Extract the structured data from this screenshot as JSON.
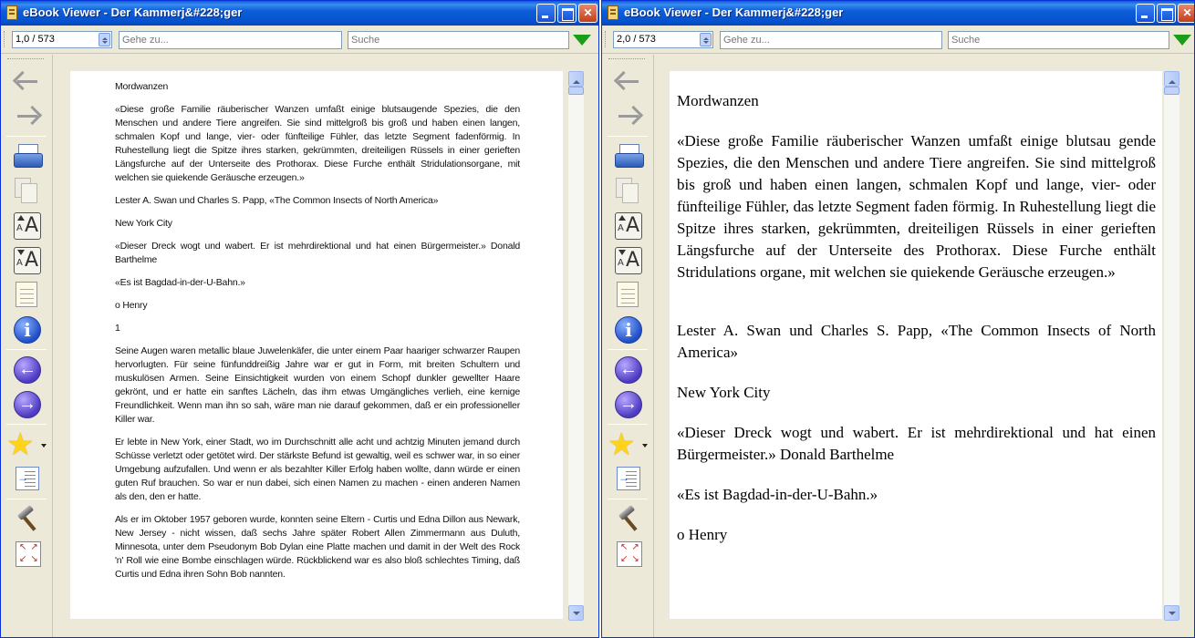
{
  "windows": [
    {
      "title": "eBook Viewer - Der Kammerj&#228;ger",
      "page_indicator": "1,0 / 573",
      "goto_placeholder": "Gehe zu...",
      "search_placeholder": "Suche",
      "paragraphs": [
        "Mordwanzen",
        "«Diese große Familie räuberischer Wanzen umfaßt einige blutsaugende Spezies, die den Menschen und andere Tiere angreifen. Sie sind mittelgroß bis groß und haben einen langen, schmalen Kopf und lange, vier- oder fünfteilige Fühler, das letzte Segment fadenförmig. In Ruhestellung liegt die Spitze ihres starken, gekrümmten, dreiteiligen Rüssels in einer gerieften Längsfurche auf der Unterseite des Prothorax. Diese Furche enthält Stridulationsorgane, mit welchen sie quiekende Geräusche erzeugen.»",
        "Lester A. Swan und Charles S. Papp, «The Common Insects of North America»",
        "New York City",
        "«Dieser Dreck wogt und wabert. Er ist mehrdirektional und hat einen Bürgermeister.» Donald Barthelme",
        "«Es ist Bagdad-in-der-U-Bahn.»",
        "o Henry",
        "1",
        "Seine Augen waren metallic blaue Juwelenkäfer, die unter einem Paar haariger schwarzer Raupen hervorlugten. Für seine fünfunddreißig Jahre war er gut in Form, mit breiten Schultern und muskulösen Armen. Seine Einsichtigkeit wurden von einem Schopf dunkler gewellter Haare gekrönt, und er hatte ein sanftes Lächeln, das ihm etwas Umgängliches verlieh, eine kernige Freundlichkeit. Wenn man ihn so sah, wäre man nie darauf gekommen, daß er ein professioneller Killer war.",
        "Er lebte in New York, einer Stadt, wo im Durchschnitt alle acht und achtzig Minuten jemand durch Schüsse verletzt oder getötet wird. Der stärkste Befund ist gewaltig, weil es schwer war, in so einer Umgebung aufzufallen. Und wenn er als bezahlter Killer Erfolg haben wollte, dann würde er einen guten Ruf brauchen. So war er nun dabei, sich einen Namen zu machen - einen anderen Namen als den, den er hatte.",
        "Als er im Oktober 1957 geboren wurde, konnten seine Eltern - Curtis und Edna Dillon aus Newark, New Jersey - nicht wissen, daß sechs Jahre später Robert Allen Zimmermann aus Duluth, Minnesota, unter dem Pseudonym Bob Dylan eine Platte machen und damit in der Welt des Rock 'n' Roll wie eine Bombe einschlagen würde. Rückblickend war es also bloß schlechtes Timing, daß Curtis und Edna ihren Sohn Bob nannten."
      ]
    },
    {
      "title": "eBook Viewer - Der Kammerj&#228;ger",
      "page_indicator": "2,0 / 573",
      "goto_placeholder": "Gehe zu...",
      "search_placeholder": "Suche",
      "paragraphs": [
        "Mordwanzen",
        "«Diese große Familie räuberischer Wanzen umfaßt einige blutsau gende Spezies, die den Menschen und andere Tiere angreifen. Sie sind mittelgroß bis groß und haben einen langen, schmalen Kopf und lange, vier- oder fünfteilige Fühler, das letzte Segment faden förmig. In Ruhestellung liegt die Spitze ihres starken, gekrümmten, dreiteiligen Rüssels in einer gerieften Längsfurche auf der Unterseite des Prothorax. Diese Furche enthält Stridulations organe, mit welchen sie quiekende Geräusche erzeugen.»",
        "Lester A. Swan und Charles S. Papp, «The Common Insects of North America»",
        "New York City",
        "«Dieser Dreck wogt und wabert. Er ist mehrdirektional und hat einen Bürgermeister.» Donald Barthelme",
        "«Es ist Bagdad-in-der-U-Bahn.»",
        "o Henry"
      ]
    }
  ],
  "icons": {
    "back": "back-arrow-icon",
    "forward": "forward-arrow-icon",
    "print": "printer-icon",
    "copy": "copy-icon",
    "font_larger": "font-larger-icon",
    "font_smaller": "font-smaller-icon",
    "notes": "notepad-icon",
    "info": "info-icon",
    "prev": "previous-icon",
    "next": "next-icon",
    "bookmark": "star-icon",
    "toc": "toc-icon",
    "prefs": "hammer-icon",
    "fullscreen": "fullscreen-icon"
  },
  "colors": {
    "titlebar": "#0a5fd8",
    "window_bg": "#ece9d8",
    "search_arrow": "#1a9e1a",
    "close_button": "#c43d1b"
  }
}
